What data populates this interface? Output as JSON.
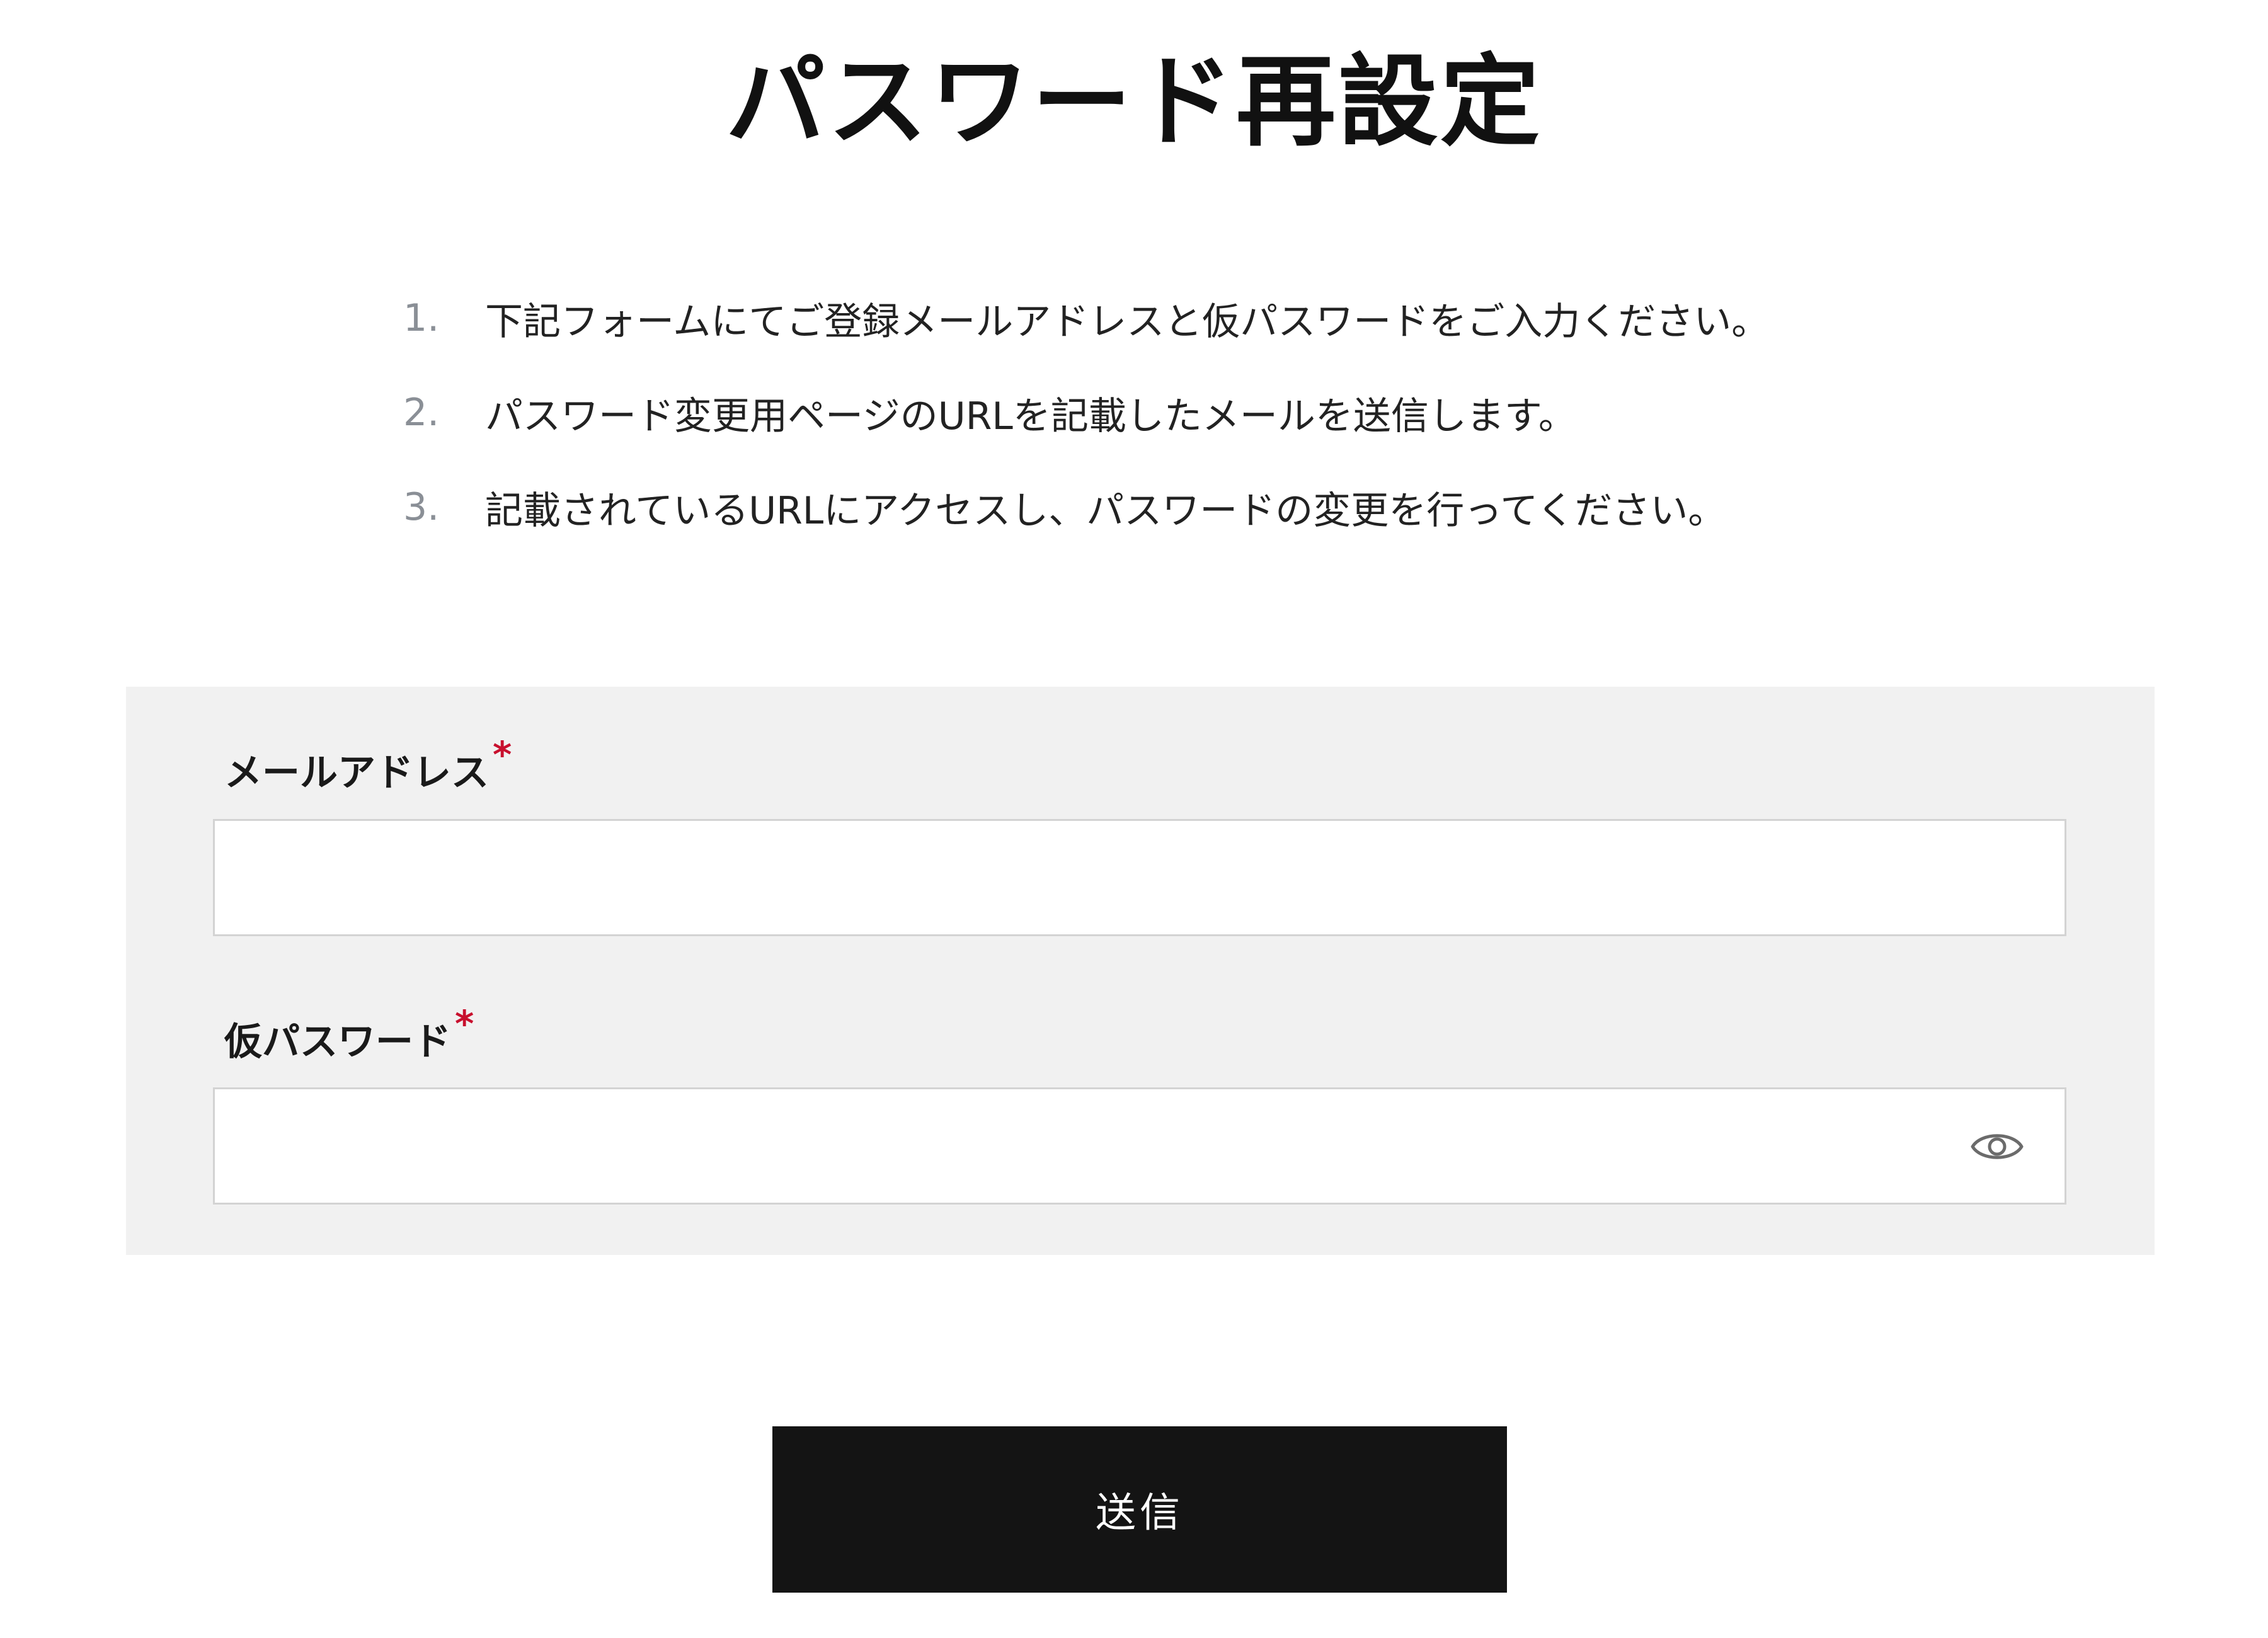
{
  "page": {
    "title": "パスワード再設定"
  },
  "instructions": [
    {
      "number": "1.",
      "text": "下記フォームにてご登録メールアドレスと仮パスワードをご入力ください。"
    },
    {
      "number": "2.",
      "text": "パスワード変更用ページのURLを記載したメールを送信します。"
    },
    {
      "number": "3.",
      "text": "記載されているURLにアクセスし、パスワードの変更を行ってください。"
    }
  ],
  "form": {
    "email": {
      "label": "メールアドレス",
      "required_mark": "*",
      "value": "",
      "placeholder": ""
    },
    "temp_password": {
      "label": "仮パスワード",
      "required_mark": "*",
      "value": "",
      "placeholder": "",
      "toggle_icon": "eye-icon"
    },
    "submit_label": "送信"
  },
  "colors": {
    "panel_background": "#f1f1f1",
    "button_background": "#141414",
    "required_mark": "#c8102e",
    "step_number": "#8a8f96"
  }
}
